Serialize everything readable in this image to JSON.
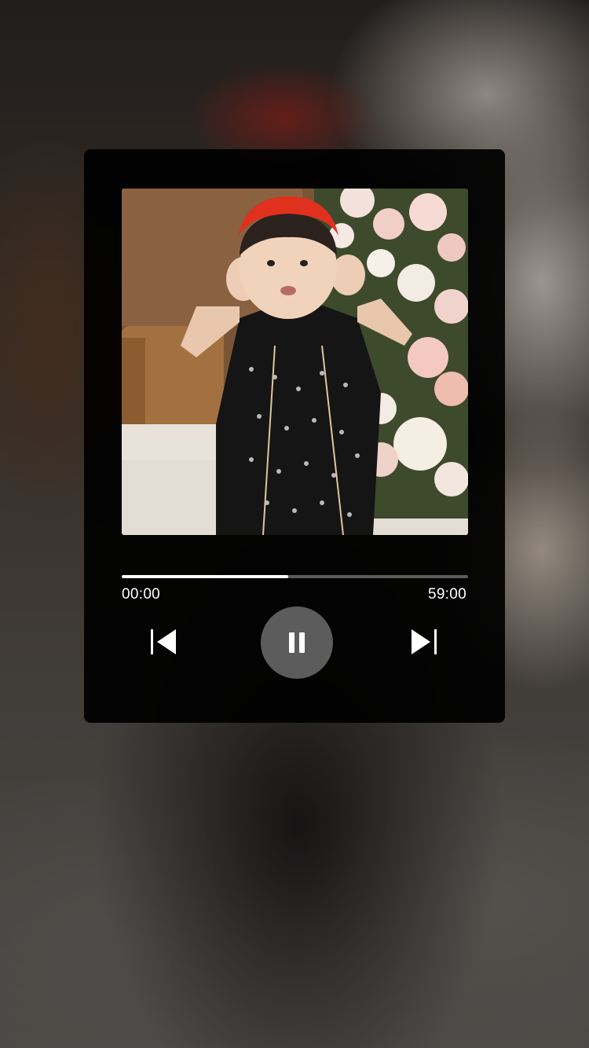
{
  "player": {
    "elapsed": "00:00",
    "total": "59:00",
    "progress_fraction": 0.48
  },
  "controls": {
    "prev_icon": "skip-previous-icon",
    "play_state_icon": "pause-icon",
    "next_icon": "skip-next-icon"
  },
  "colors": {
    "card_background": "#000000",
    "progress_fill": "#ffffff",
    "progress_track": "#5b5b5b",
    "pause_button_background": "#5c5c5c",
    "accent_red_headband": "#e0301e"
  }
}
